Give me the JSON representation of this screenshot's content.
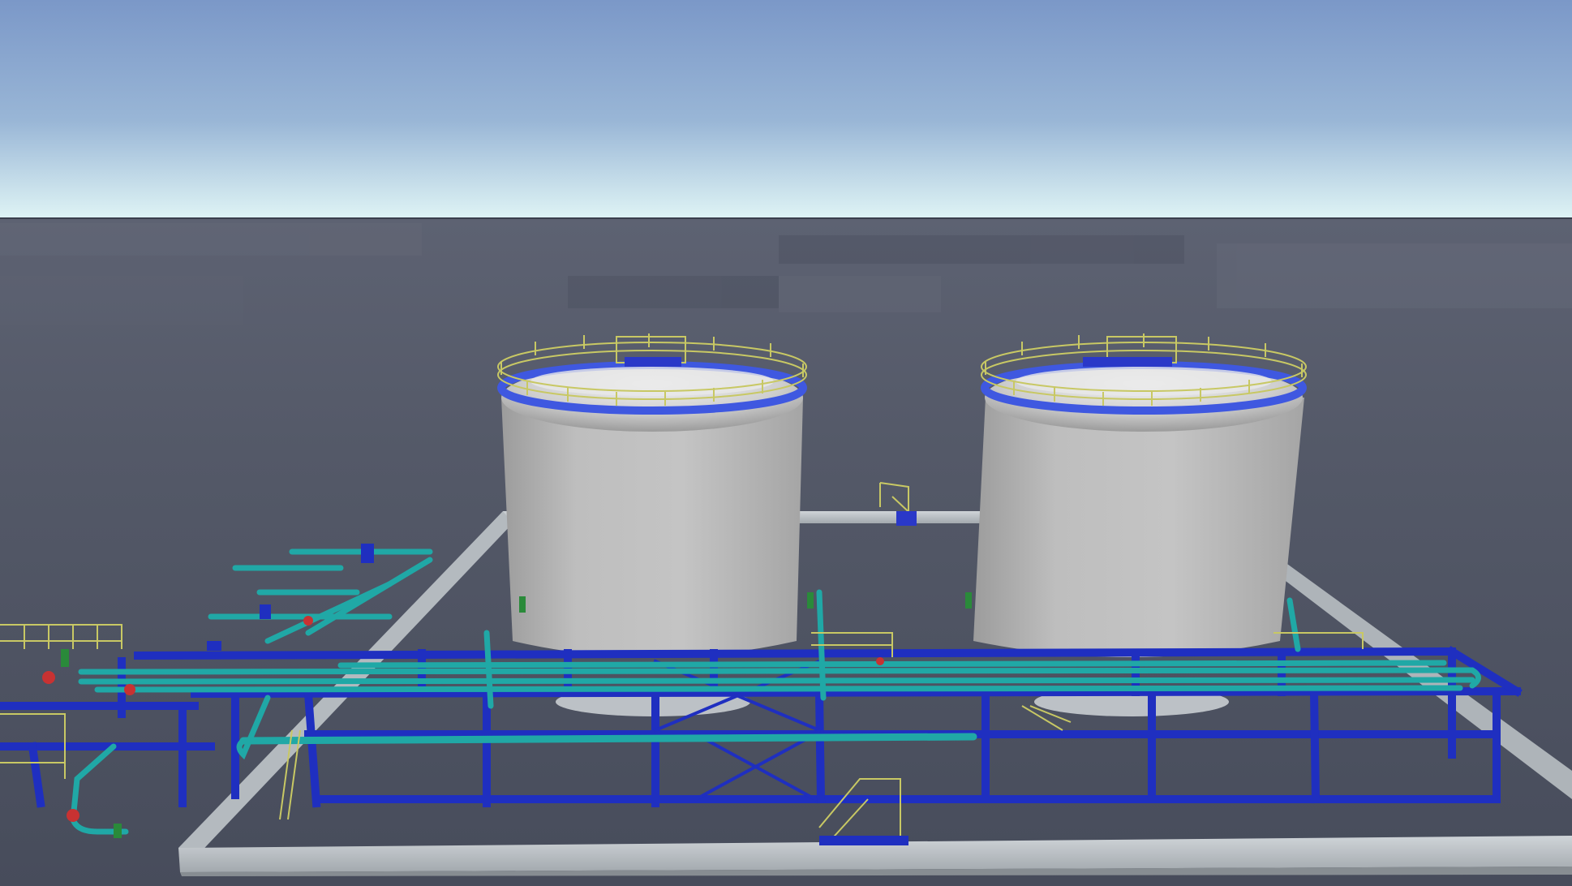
{
  "scene": {
    "sky_top": "#7e9ccb",
    "sky_horizon": "#d8f0f4",
    "ground_far": "#5c6170",
    "ground_near": "#4a4f5f",
    "tank_color": "#bdbdbd",
    "tank_shadow": "#8c8c8c",
    "steel_blue": "#1f2fc0",
    "pipe_teal": "#1fa3a3",
    "railing_yellow": "#c8c864",
    "valve_red": "#c83232",
    "valve_green": "#2a8a3a",
    "concrete": "#b9bfc4",
    "tanks": [
      {
        "id": "tank-1",
        "name": "storage-tank-left"
      },
      {
        "id": "tank-2",
        "name": "storage-tank-right"
      }
    ]
  }
}
